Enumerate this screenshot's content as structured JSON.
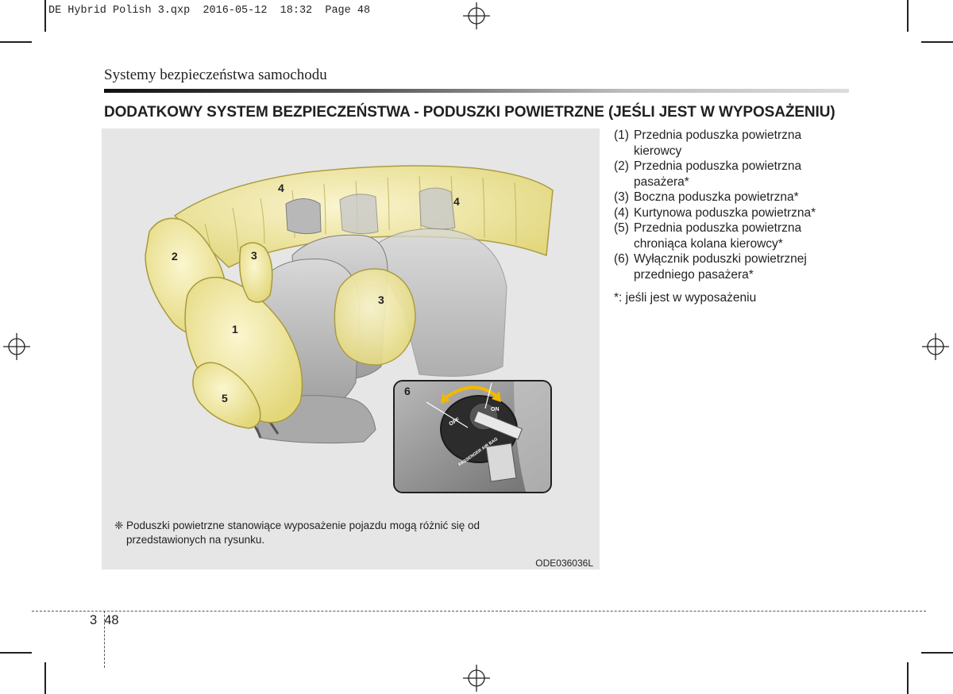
{
  "print_header": "DE Hybrid Polish 3.qxp  2016-05-12  18:32  Page 48",
  "section_title": "Systemy bezpieczeństwa samochodu",
  "heading": "DODATKOWY SYSTEM BEZPIECZEŃSTWA - PODUSZKI POWIETRZNE (JEŚLI JEST W WYPOSAŻENIU)",
  "figure": {
    "callouts": [
      "1",
      "2",
      "3",
      "3",
      "4",
      "4",
      "5",
      "6"
    ],
    "switch_labels": {
      "off": "OFF",
      "on": "ON",
      "caption": "PASSENGER AIR BAG"
    },
    "note_symbol": "❈",
    "note": "Poduszki powietrzne stanowiące wyposażenie pojazdu mogą różnić się od przedstawionych na rysunku.",
    "code": "ODE036036L",
    "colors": {
      "airbag": "#f2eaa0",
      "airbag_outline": "#a89a3a",
      "seat": "#bdbdbd",
      "background": "#e6e6e6"
    }
  },
  "legend": [
    {
      "num": "(1)",
      "text": "Przednia poduszka powietrzna kierowcy"
    },
    {
      "num": "(2)",
      "text": "Przednia poduszka powietrzna pasażera*"
    },
    {
      "num": "(3)",
      "text": "Boczna poduszka powietrzna*"
    },
    {
      "num": "(4)",
      "text": "Kurtynowa poduszka powietrzna*"
    },
    {
      "num": "(5)",
      "text": "Przednia poduszka powietrzna chroniąca kolana kierowcy*"
    },
    {
      "num": "(6)",
      "text": "Wyłącznik poduszki powietrznej przedniego pasażera*"
    }
  ],
  "footnote": "*: jeśli jest w wyposażeniu",
  "page": {
    "chapter": "3",
    "number": "48"
  }
}
